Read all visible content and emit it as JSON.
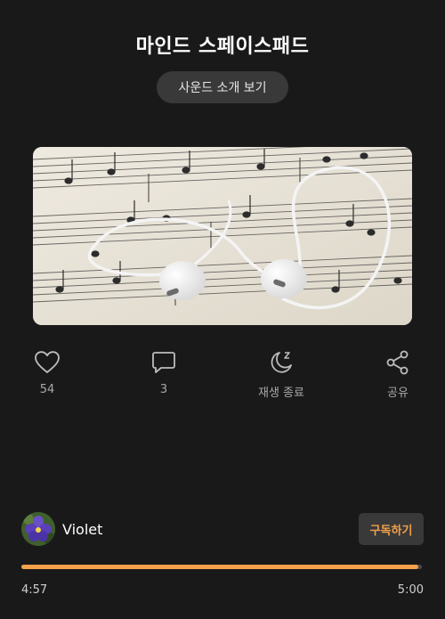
{
  "header": {
    "title": "마인드 스페이스패드",
    "intro_button": "사운드 소개 보기"
  },
  "cover": {
    "alt_icon": "earphones-on-sheet-music"
  },
  "actions": {
    "like": {
      "icon": "heart-icon",
      "count": "54"
    },
    "comment": {
      "icon": "comment-icon",
      "count": "3"
    },
    "sleep_timer": {
      "icon": "moon-icon",
      "label": "재생 종료"
    },
    "share": {
      "icon": "share-icon",
      "label": "공유"
    }
  },
  "creator": {
    "name": "Violet",
    "avatar_icon": "violet-flower"
  },
  "subscribe_button": "구독하기",
  "player": {
    "current_time": "4:57",
    "total_time": "5:00",
    "progress": 0.99
  },
  "colors": {
    "background": "#1a1919",
    "accent": "#f3a14a",
    "muted_text": "#a9a9a9"
  }
}
